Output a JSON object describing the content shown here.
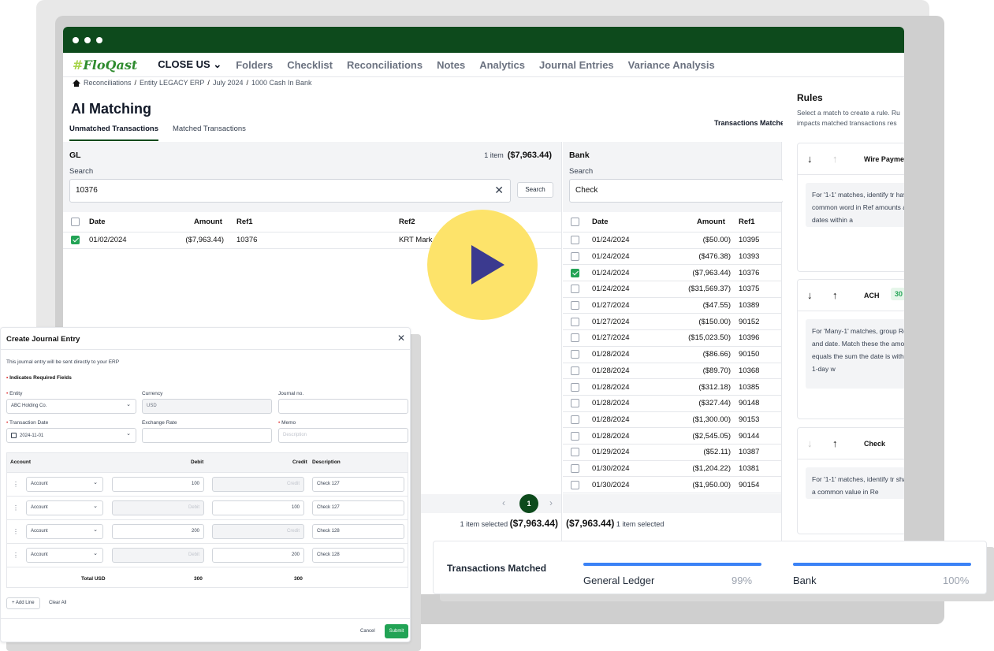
{
  "nav": {
    "logo": "FloQast",
    "logo_hash": "#",
    "items": [
      "CLOSE US",
      "Folders",
      "Checklist",
      "Reconciliations",
      "Notes",
      "Analytics",
      "Journal Entries",
      "Variance Analysis"
    ]
  },
  "breadcrumb": [
    "Reconciliations",
    "Entity LEGACY ERP",
    "July 2024",
    "1000 Cash In Bank"
  ],
  "page_title": "AI Matching",
  "tabs": [
    "Unmatched Transactions",
    "Matched Transactions"
  ],
  "transactions_matched_label": "Transactions Matche",
  "gl": {
    "title": "GL",
    "count_text": "1 item",
    "count_amount": "($7,963.44)",
    "search_label": "Search",
    "search_value": "10376",
    "search_button": "Search",
    "columns": [
      "Date",
      "Amount",
      "Ref1",
      "Ref2"
    ],
    "rows": [
      {
        "checked": true,
        "date": "01/02/2024",
        "amount": "($7,963.44)",
        "ref1": "10376",
        "ref2": "KRT Mark"
      }
    ],
    "footer_text": "1 item selected",
    "footer_amount": "($7,963.44)"
  },
  "bank": {
    "title": "Bank",
    "search_label": "Search",
    "search_value": "Check",
    "columns": [
      "Date",
      "Amount",
      "Ref1"
    ],
    "rows": [
      {
        "checked": false,
        "date": "01/24/2024",
        "amount": "($50.00)",
        "ref1": "10395"
      },
      {
        "checked": false,
        "date": "01/24/2024",
        "amount": "($476.38)",
        "ref1": "10393"
      },
      {
        "checked": true,
        "date": "01/24/2024",
        "amount": "($7,963.44)",
        "ref1": "10376"
      },
      {
        "checked": false,
        "date": "01/24/2024",
        "amount": "($31,569.37)",
        "ref1": "10375"
      },
      {
        "checked": false,
        "date": "01/27/2024",
        "amount": "($47.55)",
        "ref1": "10389"
      },
      {
        "checked": false,
        "date": "01/27/2024",
        "amount": "($150.00)",
        "ref1": "90152"
      },
      {
        "checked": false,
        "date": "01/27/2024",
        "amount": "($15,023.50)",
        "ref1": "10396"
      },
      {
        "checked": false,
        "date": "01/28/2024",
        "amount": "($86.66)",
        "ref1": "90150"
      },
      {
        "checked": false,
        "date": "01/28/2024",
        "amount": "($89.70)",
        "ref1": "10368"
      },
      {
        "checked": false,
        "date": "01/28/2024",
        "amount": "($312.18)",
        "ref1": "10385"
      },
      {
        "checked": false,
        "date": "01/28/2024",
        "amount": "($327.44)",
        "ref1": "90148"
      },
      {
        "checked": false,
        "date": "01/28/2024",
        "amount": "($1,300.00)",
        "ref1": "90153"
      },
      {
        "checked": false,
        "date": "01/28/2024",
        "amount": "($2,545.05)",
        "ref1": "90144"
      },
      {
        "checked": false,
        "date": "01/29/2024",
        "amount": "($52.11)",
        "ref1": "10387"
      },
      {
        "checked": false,
        "date": "01/30/2024",
        "amount": "($1,204.22)",
        "ref1": "10381"
      },
      {
        "checked": false,
        "date": "01/30/2024",
        "amount": "($1,950.00)",
        "ref1": "90154"
      }
    ],
    "page": "1",
    "footer_amount": "($7,963.44)",
    "footer_text": "1 item selected"
  },
  "rules": {
    "title": "Rules",
    "desc": "Select a match to create a rule. Ru impacts matched transactions res",
    "cards": [
      {
        "name": "Wire Payme",
        "badge": "",
        "body": "For '1-1' matches, identify tr have a common word in Ref amounts and dates within a"
      },
      {
        "name": "ACH",
        "badge": "30",
        "body": "For 'Many-1' matches, group Ref1 and date. Match these the amount equals the sum the date is within a 1-day w"
      },
      {
        "name": "Check",
        "badge": "",
        "body": "For '1-1' matches, identify tr share a common value in Re"
      }
    ]
  },
  "journal_entry": {
    "title": "Create Journal Entry",
    "note": "This journal entry will be sent directly to your ERP",
    "required_note": "Indicates Required Fields",
    "entity_label": "Entity",
    "entity_value": "ABC Holding Co.",
    "currency_label": "Currency",
    "currency_value": "USD",
    "journal_no_label": "Journal no.",
    "transaction_date_label": "Transaction Date",
    "transaction_date_value": "2024-11-01",
    "exchange_rate_label": "Exchange Rate",
    "memo_label": "Memo",
    "memo_placeholder": "Description",
    "columns": [
      "Account",
      "Debit",
      "Credit",
      "Description"
    ],
    "lines": [
      {
        "account": "Account",
        "debit": "100",
        "credit": "Credit",
        "description": "Check 127"
      },
      {
        "account": "Account",
        "debit": "Debit",
        "credit": "100",
        "description": "Check 127"
      },
      {
        "account": "Account",
        "debit": "200",
        "credit": "Credit",
        "description": "Check 128"
      },
      {
        "account": "Account",
        "debit": "Debit",
        "credit": "200",
        "description": "Check 128"
      }
    ],
    "total_label": "Total USD",
    "total_debit": "300",
    "total_credit": "300",
    "add_line": "Add Line",
    "clear_all": "Clear All",
    "cancel": "Cancel",
    "submit": "Submit"
  },
  "matched_card": {
    "title": "Transactions Matched",
    "general_ledger_label": "General Ledger",
    "general_ledger_pct": "99%",
    "bank_label": "Bank",
    "bank_pct": "100%"
  },
  "colors": {
    "brand_green": "#0d4a1c",
    "check_green": "#22a355",
    "play_yellow": "#fde36a",
    "bar_blue": "#3b82f6"
  }
}
